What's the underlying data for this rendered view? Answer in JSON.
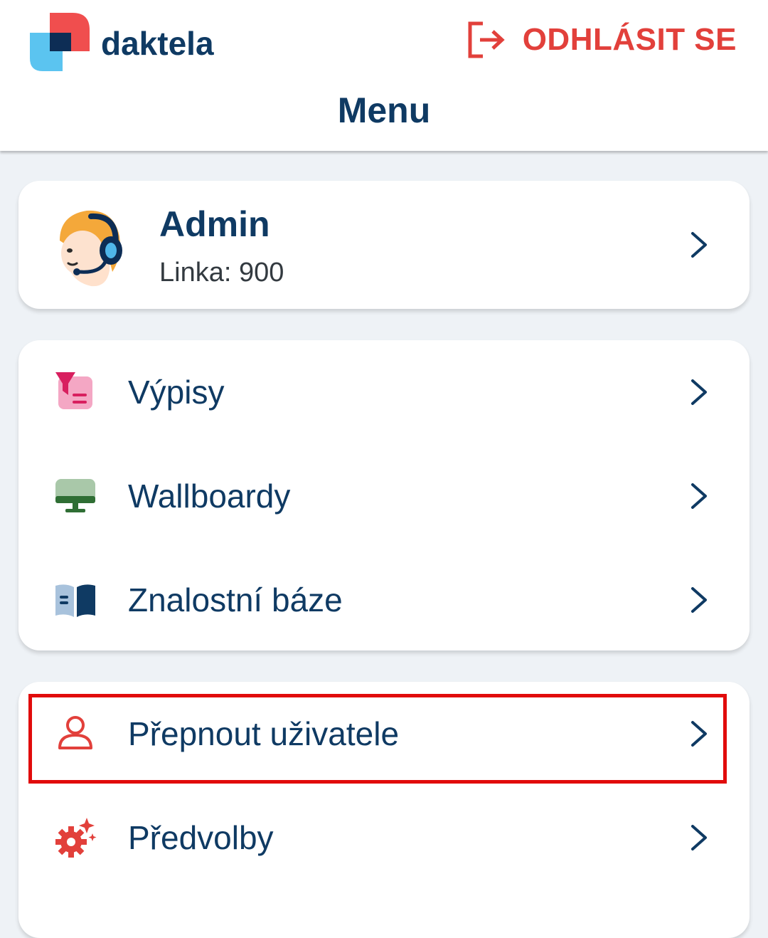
{
  "header": {
    "logo_text": "daktela",
    "logout_label": "ODHLÁSIT SE",
    "title": "Menu"
  },
  "profile": {
    "name": "Admin",
    "line": "Linka: 900"
  },
  "menu_groups": [
    {
      "items": [
        {
          "label": "Výpisy",
          "icon": "filter-list-icon"
        },
        {
          "label": "Wallboardy",
          "icon": "monitor-icon"
        },
        {
          "label": "Znalostní báze",
          "icon": "book-icon"
        }
      ]
    },
    {
      "items": [
        {
          "label": "Přepnout uživatele",
          "icon": "user-icon",
          "highlighted": true
        },
        {
          "label": "Předvolby",
          "icon": "gear-sparkle-icon"
        }
      ]
    }
  ],
  "colors": {
    "primary": "#0f3a63",
    "accent_red": "#e2403b",
    "highlight": "#e10b0b",
    "background": "#eef2f6"
  }
}
